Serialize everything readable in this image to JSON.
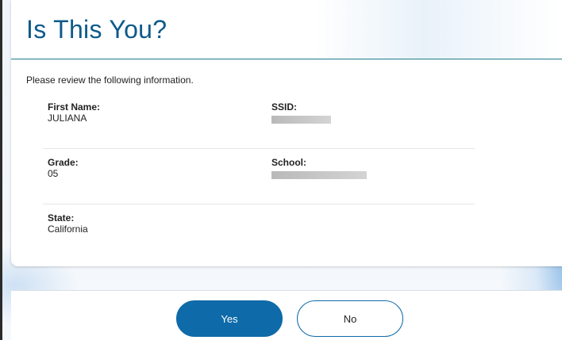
{
  "header": {
    "title": "Is This You?"
  },
  "intro": "Please review the following information.",
  "fields": {
    "first_name": {
      "label": "First Name:",
      "value": "JULIANA"
    },
    "ssid": {
      "label": "SSID:"
    },
    "grade": {
      "label": "Grade:",
      "value": "05"
    },
    "school": {
      "label": "School:"
    },
    "state": {
      "label": "State:",
      "value": "California"
    }
  },
  "buttons": {
    "yes": "Yes",
    "no": "No"
  },
  "colors": {
    "accent": "#0e6aa8",
    "title": "#0e5a8a"
  }
}
